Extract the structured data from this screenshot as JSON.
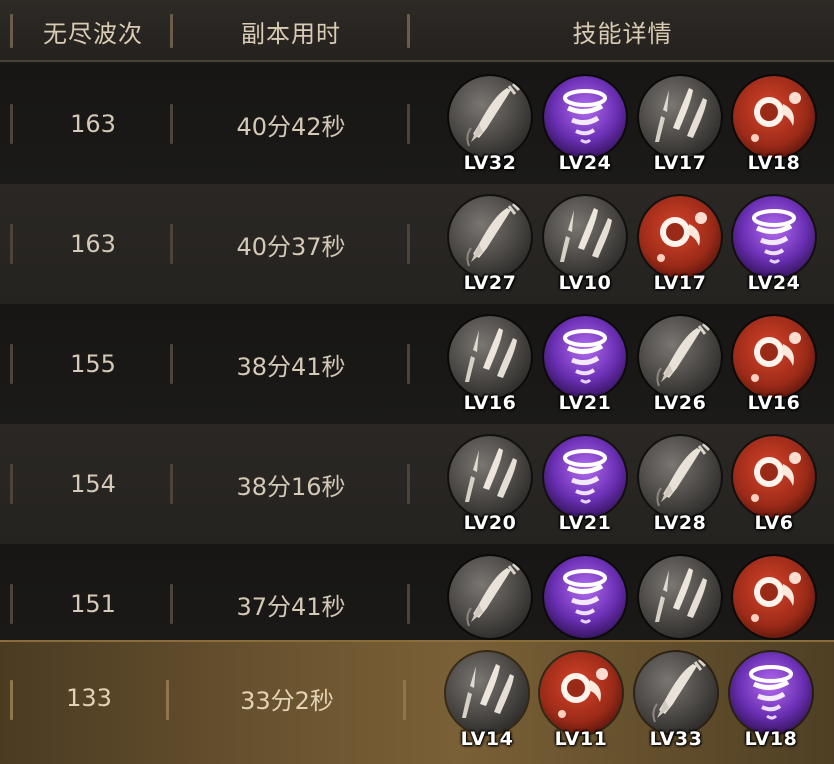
{
  "header": {
    "wave": "无尽波次",
    "time": "副本用时",
    "skills": "技能详情"
  },
  "colors": {
    "grey_orb": "#4b4845",
    "purple_orb": "#6a2fb3",
    "red_orb": "#9a2a18",
    "highlight_row": "#6b5430"
  },
  "rows": [
    {
      "wave": "163",
      "time": "40分42秒",
      "skills": [
        {
          "icon": "single-arrow-icon",
          "level": "LV32"
        },
        {
          "icon": "purple-tornado-icon",
          "level": "LV24"
        },
        {
          "icon": "multi-arrow-icon",
          "level": "LV17"
        },
        {
          "icon": "fireball-icon",
          "level": "LV18"
        }
      ]
    },
    {
      "wave": "163",
      "time": "40分37秒",
      "skills": [
        {
          "icon": "single-arrow-icon",
          "level": "LV27"
        },
        {
          "icon": "multi-arrow-icon",
          "level": "LV10"
        },
        {
          "icon": "fireball-icon",
          "level": "LV17"
        },
        {
          "icon": "purple-tornado-icon",
          "level": "LV24"
        }
      ]
    },
    {
      "wave": "155",
      "time": "38分41秒",
      "skills": [
        {
          "icon": "multi-arrow-icon",
          "level": "LV16"
        },
        {
          "icon": "purple-tornado-icon",
          "level": "LV21"
        },
        {
          "icon": "single-arrow-icon",
          "level": "LV26"
        },
        {
          "icon": "fireball-icon",
          "level": "LV16"
        }
      ]
    },
    {
      "wave": "154",
      "time": "38分16秒",
      "skills": [
        {
          "icon": "multi-arrow-icon",
          "level": "LV20"
        },
        {
          "icon": "purple-tornado-icon",
          "level": "LV21"
        },
        {
          "icon": "single-arrow-icon",
          "level": "LV28"
        },
        {
          "icon": "fireball-icon",
          "level": "LV6"
        }
      ]
    },
    {
      "wave": "151",
      "time": "37分41秒",
      "skills": [
        {
          "icon": "single-arrow-icon",
          "level": ""
        },
        {
          "icon": "purple-tornado-icon",
          "level": ""
        },
        {
          "icon": "multi-arrow-icon",
          "level": ""
        },
        {
          "icon": "fireball-icon",
          "level": ""
        }
      ]
    },
    {
      "wave": "133",
      "time": "33分2秒",
      "skills": [
        {
          "icon": "multi-arrow-icon",
          "level": "LV14"
        },
        {
          "icon": "fireball-icon",
          "level": "LV11"
        },
        {
          "icon": "single-arrow-icon",
          "level": "LV33"
        },
        {
          "icon": "purple-tornado-icon",
          "level": "LV18"
        }
      ]
    }
  ]
}
